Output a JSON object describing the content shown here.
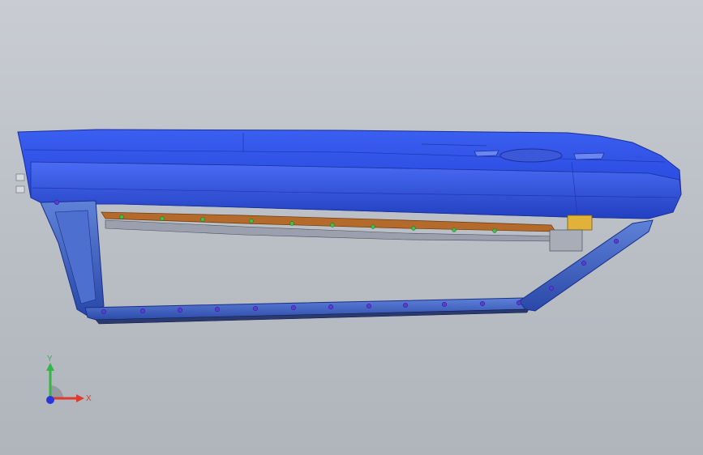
{
  "viewport": {
    "background_top": "#c9ccd3",
    "background_bottom": "#b0b4bb"
  },
  "model": {
    "body_color": "#2f53e6",
    "frame_color": "#2b4ec9",
    "trim_color": "#b36a2a",
    "bracket_color": "#e0b23a",
    "fastener_color": "#5a3bd6",
    "clip_color": "#3fbf4a"
  },
  "triad": {
    "y_label": "Y",
    "x_label": "X",
    "y_color": "#33b54a",
    "x_color": "#e03a2f",
    "origin_color": "#2b35d9"
  }
}
